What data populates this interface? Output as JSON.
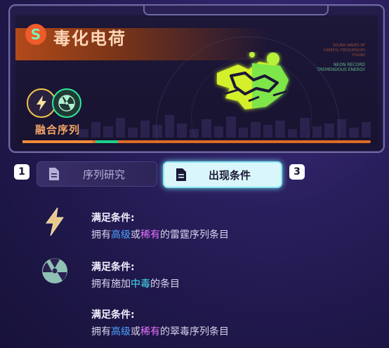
{
  "card": {
    "title": "毒化电荷",
    "title_icon": "s-rune-icon",
    "fusion_label": "融合序列",
    "fusion_icons": [
      "lightning-icon",
      "radiation-icon"
    ],
    "deco_text": [
      "SOUND WAVES OF",
      "CAREFUL FREQUENCIES",
      "FOUND",
      "NEON RECORD",
      "TREMENDOUS ENERGY"
    ],
    "colors": {
      "accent": "#e06a2a",
      "toxic": "#c8f02a",
      "cyan": "#8ae6f0"
    }
  },
  "tabs": [
    {
      "number": "1",
      "label": "序列研究",
      "active": false,
      "icon": "document-icon"
    },
    {
      "number": "3",
      "label": "出现条件",
      "active": true,
      "icon": "document-icon"
    }
  ],
  "conditions": [
    {
      "icon": "lightning-icon",
      "title": "满足条件:",
      "desc_parts": [
        "拥有",
        "高级",
        "或",
        "稀有",
        "的雷霆序列条目"
      ]
    },
    {
      "icon": "radiation-icon",
      "title": "满足条件:",
      "desc_parts": [
        "拥有施加",
        "中毒",
        "的条目"
      ]
    },
    {
      "icon": "radiation-icon",
      "title": "满足条件:",
      "desc_parts": [
        "拥有",
        "高级",
        "或",
        "稀有",
        "的翠毒序列条目"
      ]
    }
  ]
}
